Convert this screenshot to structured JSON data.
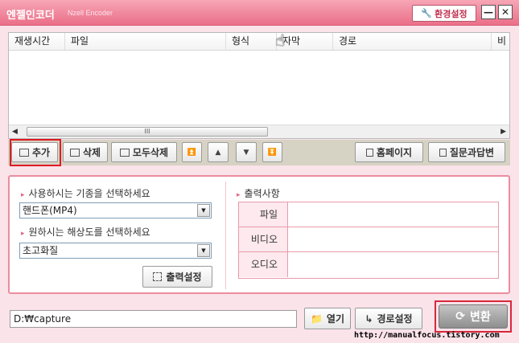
{
  "window": {
    "title": "엔젤인코더",
    "subtitle": "Nzell Encoder",
    "settings_label": "환경설정",
    "minimize_label": "—",
    "close_label": "✕"
  },
  "file_list": {
    "columns": [
      "재생시간",
      "파일",
      "형식",
      "자막",
      "경로",
      "비"
    ],
    "scroll_thumb_label": "III"
  },
  "toolbar": {
    "add_label": "추가",
    "delete_label": "삭제",
    "delete_all_label": "모두삭제",
    "move_top_glyph": "⏫",
    "move_up_glyph": "▲",
    "move_down_glyph": "▼",
    "move_bottom_glyph": "⏬",
    "homepage_label": "홈페이지",
    "faq_label": "질문과답변"
  },
  "settings": {
    "device_prompt": "사용하시는 기종을 선택하세요",
    "device_value": "핸드폰(MP4)",
    "resolution_prompt": "원하시는 해상도를 선택하세요",
    "resolution_value": "초고화질",
    "output_settings_label": "출력설정",
    "output_heading": "출력사항",
    "output_rows": [
      {
        "label": "파일",
        "value": ""
      },
      {
        "label": "비디오",
        "value": ""
      },
      {
        "label": "오디오",
        "value": ""
      }
    ]
  },
  "bottom": {
    "path_value": "D:₩capture",
    "open_label": "열기",
    "path_settings_label": "경로설정",
    "convert_label": "변환",
    "watermark": "http://manualfocus.tistory.com"
  },
  "colors": {
    "accent": "#ea6f88",
    "highlight": "#e01b22"
  }
}
